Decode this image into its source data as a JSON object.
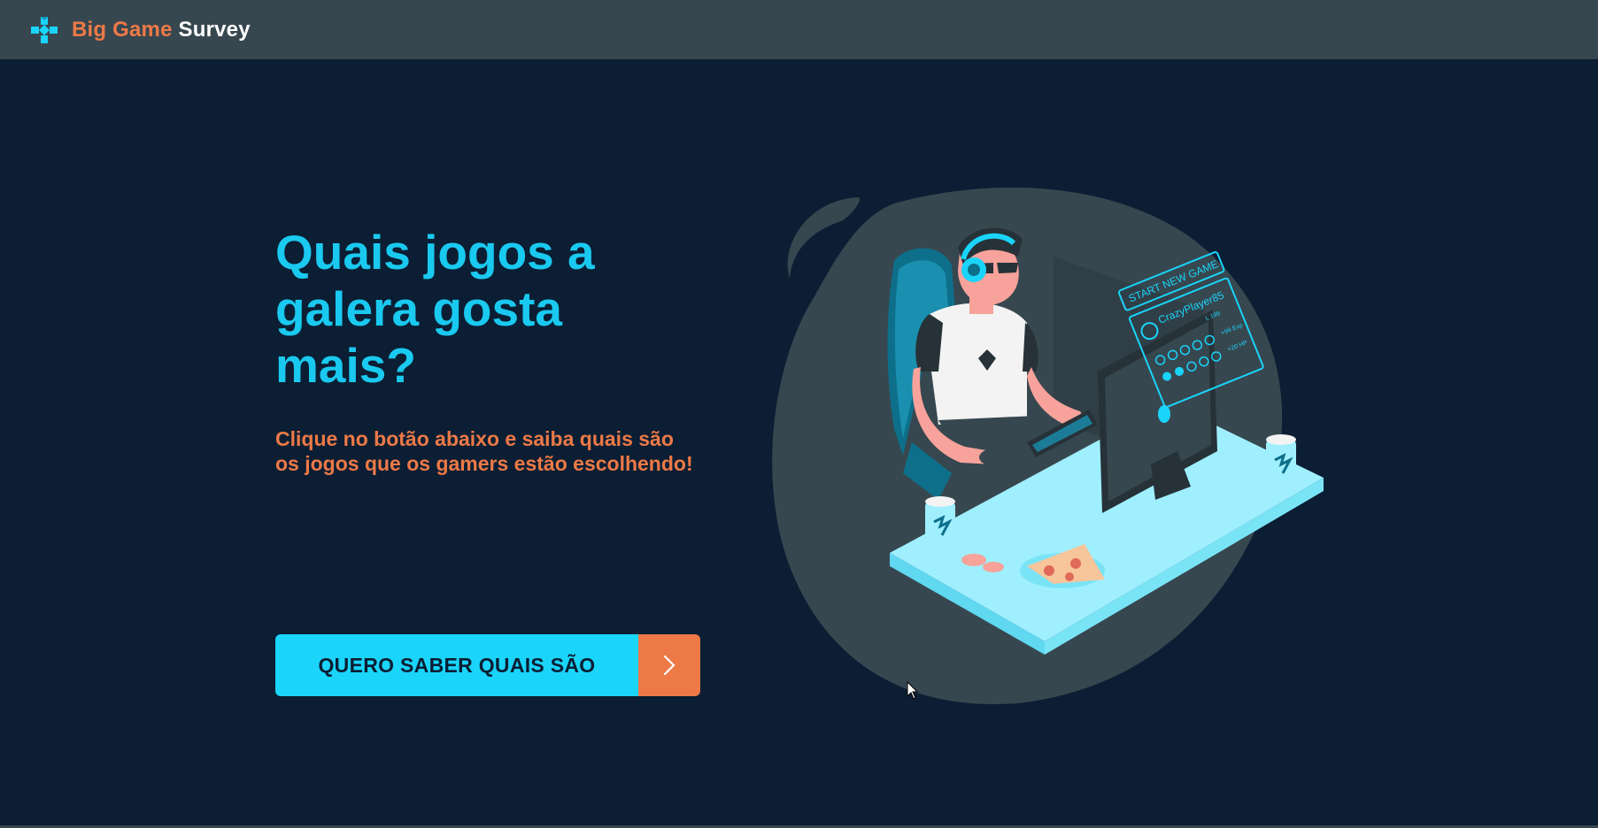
{
  "navbar": {
    "logo_icon": "gamepad-icon",
    "brand_part1": "Big Game",
    "brand_part2": "Survey"
  },
  "hero": {
    "title": "Quais jogos a galera gosta mais?",
    "subtitle": "Clique no botão abaixo e saiba quais são os jogos que os gamers estão escolhendo!",
    "cta_label": "QUERO SABER QUAIS SÃO",
    "cta_icon": "chevron-right-icon"
  },
  "illustration": {
    "screen_header": "START NEW GAME",
    "player_name": "CrazyPlayer85",
    "level": "L 199",
    "stat_exp": "+99 Exp",
    "stat_hp": "+20 HP"
  },
  "colors": {
    "navbar_bg": "#37474f",
    "page_bg": "#0b1e33",
    "accent_cyan": "#1ac9f0",
    "accent_orange": "#ed7947"
  }
}
